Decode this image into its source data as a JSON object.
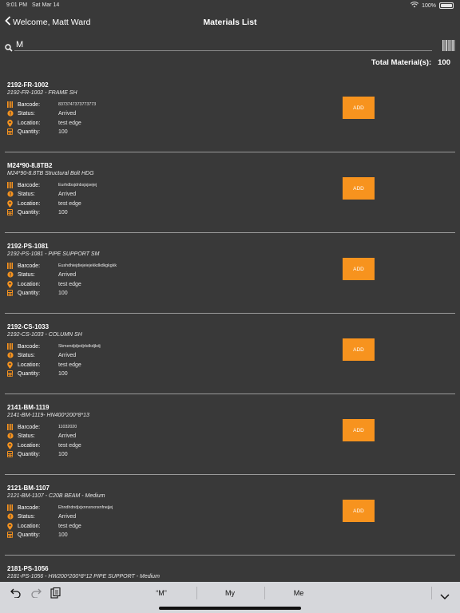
{
  "status_bar": {
    "time": "9:01 PM",
    "date": "Sat Mar 14",
    "battery": "100%",
    "icons": [
      "wifi-icon",
      "battery-icon"
    ]
  },
  "nav": {
    "back_label": "Welcome, Matt Ward",
    "title": "Materials List"
  },
  "search": {
    "value": "M",
    "placeholder": ""
  },
  "total": {
    "label": "Total Material(s):",
    "value": "100"
  },
  "field_labels": {
    "barcode": "Barcode:",
    "status": "Status:",
    "location": "Location:",
    "quantity": "Quantity:"
  },
  "add_label": "ADD",
  "materials": [
    {
      "code": "2192-FR-1002",
      "description": "2192-FR-1002 - FRAME SH",
      "barcode": "8373747373773773",
      "status": "Arrived",
      "location": "test edge",
      "quantity": "100"
    },
    {
      "code": "M24*90-8.8TB2",
      "description": "M24*90-8.8TB Structural Bolt HDG",
      "barcode": "Eurhdbsjdnbsjsjsejej",
      "status": "Arrived",
      "location": "test edge",
      "quantity": "100"
    },
    {
      "code": "2192-PS-1081",
      "description": "2192-PS-1081 - PIPE SUPPORT SM",
      "barcode": "Eushdhiejdiejeiejekkdkdkgkgkk",
      "status": "Arrived",
      "location": "test edge",
      "quantity": "100"
    },
    {
      "code": "2192-CS-1033",
      "description": "2192-CS-1033 - COLUMN SH",
      "barcode": "Skmendjdjedjrkdkdjkdj",
      "status": "Arrived",
      "location": "test edge",
      "quantity": "100"
    },
    {
      "code": "2141-BM-1119",
      "description": "2141-BM-1119- HN400*200*8*13",
      "barcode": "11032020",
      "status": "Arrived",
      "location": "test edge",
      "quantity": "100"
    },
    {
      "code": "2121-BM-1107",
      "description": "2121-BM-1107 - C20B BEAM - Medium",
      "barcode": "Ehndhdndjxjxnnxnxnxnfnejjej",
      "status": "Arrived",
      "location": "test edge",
      "quantity": "100"
    },
    {
      "code": "2181-PS-1056",
      "description": "2181-PS-1056 - HW200*200*8*12 PIPE SUPPORT - Medium"
    }
  ],
  "keyboard": {
    "suggestions": [
      "“M”",
      "My",
      "Me"
    ],
    "tools": [
      "undo-icon",
      "redo-icon",
      "paste-icon",
      "chevron-down-icon"
    ]
  },
  "colors": {
    "background": "#393939",
    "accent": "#f7931e",
    "keyboard": "#d6d7db"
  }
}
